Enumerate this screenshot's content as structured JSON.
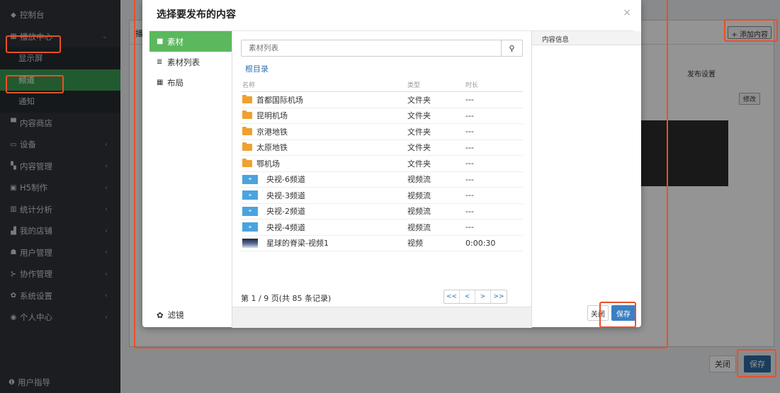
{
  "sidebar": {
    "items": [
      {
        "icon": "dashboard-icon",
        "glyph": "◆",
        "label": "控制台"
      },
      {
        "icon": "grid-icon",
        "glyph": "▦",
        "label": "播放中心"
      },
      {
        "icon": "",
        "glyph": "",
        "label": "显示屏"
      },
      {
        "icon": "",
        "glyph": "",
        "label": "频道"
      },
      {
        "icon": "",
        "glyph": "",
        "label": "通知"
      },
      {
        "icon": "store-icon",
        "glyph": "▀",
        "label": "内容商店"
      },
      {
        "icon": "monitor-icon",
        "glyph": "▭",
        "label": "设备"
      },
      {
        "icon": "copy-icon",
        "glyph": "▚",
        "label": "内容管理"
      },
      {
        "icon": "h5-icon",
        "glyph": "▣",
        "label": "H5制作"
      },
      {
        "icon": "chart-icon",
        "glyph": "▥",
        "label": "统计分析"
      },
      {
        "icon": "bank-icon",
        "glyph": "▟",
        "label": "我的店铺"
      },
      {
        "icon": "users-icon",
        "glyph": "☗",
        "label": "用户管理"
      },
      {
        "icon": "sitemap-icon",
        "glyph": "⊱",
        "label": "协作管理"
      },
      {
        "icon": "gear-icon",
        "glyph": "✿",
        "label": "系统设置"
      },
      {
        "icon": "user-circle-icon",
        "glyph": "◉",
        "label": "个人中心"
      }
    ],
    "guide_label": "用户指导",
    "guide_glyph": "❶"
  },
  "main": {
    "panel_label": "播放中",
    "add_content": "+ 添加内容",
    "publish_settings": "发布设置",
    "edit": "修改",
    "close": "关闭",
    "save": "保存"
  },
  "modal": {
    "title": "选择要发布的内容",
    "close_glyph": "×",
    "tabs": [
      {
        "icon": "folder-icon",
        "glyph": "■",
        "label": "素材"
      },
      {
        "icon": "list-icon",
        "glyph": "≣",
        "label": "素材列表"
      },
      {
        "icon": "layout-icon",
        "glyph": "▦",
        "label": "布局"
      }
    ],
    "filter_label": "滤镜",
    "filter_glyph": "✿",
    "search_placeholder": "素材列表",
    "search_glyph": "⚲",
    "root_dir": "根目录",
    "columns": [
      "名称",
      "类型",
      "时长"
    ],
    "rows": [
      {
        "kind": "folder",
        "name": "首都国际机场",
        "type": "文件夹",
        "duration": "---"
      },
      {
        "kind": "folder",
        "name": "昆明机场",
        "type": "文件夹",
        "duration": "---"
      },
      {
        "kind": "folder",
        "name": "京港地铁",
        "type": "文件夹",
        "duration": "---"
      },
      {
        "kind": "folder",
        "name": "太原地铁",
        "type": "文件夹",
        "duration": "---"
      },
      {
        "kind": "folder",
        "name": "鄂机场",
        "type": "文件夹",
        "duration": "---"
      },
      {
        "kind": "stream",
        "name": "央视-6频道",
        "type": "视频流",
        "duration": "---"
      },
      {
        "kind": "stream",
        "name": "央视-3频道",
        "type": "视频流",
        "duration": "---"
      },
      {
        "kind": "stream",
        "name": "央视-2频道",
        "type": "视频流",
        "duration": "---"
      },
      {
        "kind": "stream",
        "name": "央视-4频道",
        "type": "视频流",
        "duration": "---"
      },
      {
        "kind": "video",
        "name": "星球的脊梁-视频1",
        "type": "视频",
        "duration": "0:00:30"
      }
    ],
    "pager_info": "第 1 / 9 页(共 85 条记录)",
    "pager_buttons": [
      "<<",
      "<",
      ">",
      ">>"
    ],
    "info_title": "内容信息",
    "close_btn": "关闭",
    "save_btn": "保存"
  },
  "colors": {
    "sidebar_bg": "#2f3338",
    "active_green": "#5cb85c",
    "primary_blue": "#3b7fc4",
    "highlight": "#e8502a",
    "folder": "#f0a030"
  }
}
